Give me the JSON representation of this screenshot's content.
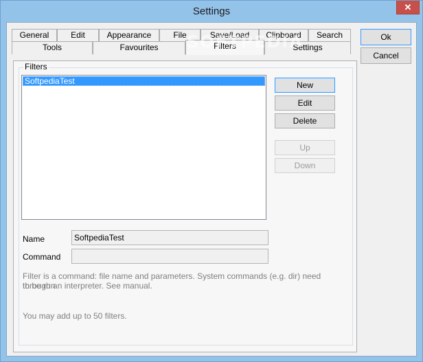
{
  "window": {
    "title": "Settings",
    "close_glyph": "✕"
  },
  "tabs_row1": [
    "General",
    "Edit",
    "Appearance",
    "File",
    "Save/Load",
    "Clipboard",
    "Search"
  ],
  "tabs_row2": [
    "Tools",
    "Favourites",
    "Filters",
    "Settings"
  ],
  "active_tab": "Filters",
  "filters": {
    "group_title": "Filters",
    "items": [
      "SoftpediaTest"
    ],
    "buttons": {
      "new": "New",
      "edit": "Edit",
      "delete": "Delete",
      "up": "Up",
      "down": "Down"
    },
    "name_label": "Name",
    "name_value": "SoftpediaTest",
    "command_label": "Command",
    "command_value": "",
    "note_line1": "Filter is a command: file name and parameters. System commands (e.g. dir) need to be run",
    "note_line2": "through an interpreter. See manual.",
    "limit_note": "You may add up to 50 filters."
  },
  "dialog_buttons": {
    "ok": "Ok",
    "cancel": "Cancel"
  },
  "watermark": "SOFTPEDIA",
  "colors": {
    "titlebar": "#94c3ea",
    "selection": "#3399ff",
    "close": "#c7504a"
  }
}
